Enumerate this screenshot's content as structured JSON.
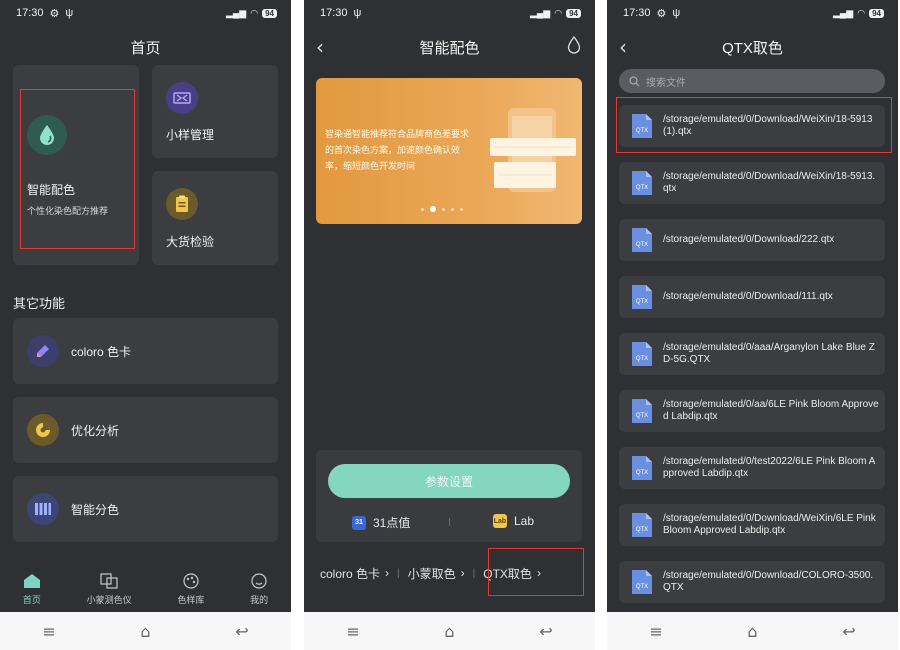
{
  "status": {
    "time": "17:30",
    "battery": "94"
  },
  "screen1": {
    "title": "首页",
    "card_main": {
      "title": "智能配色",
      "subtitle": "个性化染色配方推荐"
    },
    "card_sample": {
      "title": "小样管理"
    },
    "card_bulk": {
      "title": "大货检验"
    },
    "section_title": "其它功能",
    "items": [
      {
        "label": "coloro 色卡",
        "icon": "pencil-icon"
      },
      {
        "label": "优化分析",
        "icon": "pie-icon"
      },
      {
        "label": "智能分色",
        "icon": "bars-icon"
      }
    ],
    "tabs": [
      {
        "label": "首页",
        "icon": "home-icon",
        "active": true
      },
      {
        "label": "小蒙测色仪",
        "icon": "device-icon",
        "active": false
      },
      {
        "label": "色样库",
        "icon": "palette-icon",
        "active": false
      },
      {
        "label": "我的",
        "icon": "face-icon",
        "active": false
      }
    ]
  },
  "screen2": {
    "title": "智能配色",
    "banner_text": "智染通智能推荐符合品牌商色差要求的首次染色方案，加速颜色确认效率，缩短颜色开发时间",
    "param_button": "参数设置",
    "option_31": {
      "badge": "31",
      "label": "31点值"
    },
    "option_lab": {
      "badge": "Lab",
      "label": "Lab"
    },
    "links": [
      "coloro 色卡",
      "小蒙取色",
      "QTX取色"
    ]
  },
  "screen3": {
    "title": "QTX取色",
    "search_placeholder": "搜索文件",
    "files": [
      "/storage/emulated/0/Download/WeiXin/18-5913 (1).qtx",
      "/storage/emulated/0/Download/WeiXin/18-5913.qtx",
      "/storage/emulated/0/Download/222.qtx",
      "/storage/emulated/0/Download/111.qtx",
      "/storage/emulated/0/aaa/Arganylon Lake Blue ZD-5G.QTX",
      "/storage/emulated/0/aa/6LE Pink Bloom Approved Labdip.qtx",
      "/storage/emulated/0/test2022/6LE Pink Bloom Approved Labdip.qtx",
      "/storage/emulated/0/Download/WeiXin/6LE Pink Bloom Approved Labdip.qtx",
      "/storage/emulated/0/Download/COLORO-3500.QTX"
    ],
    "file_icon_label": "QTX"
  },
  "colors": {
    "accent": "#84d6bf",
    "card": "#3c3d41",
    "bg": "#2f3033",
    "highlight": "#e53935"
  }
}
